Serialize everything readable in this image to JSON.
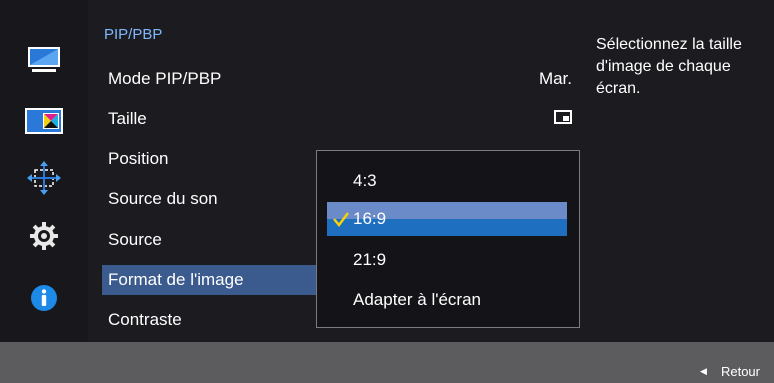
{
  "menu": {
    "title": "PIP/PBP",
    "items": [
      {
        "label": "Mode PIP/PBP",
        "value": "Mar."
      },
      {
        "label": "Taille",
        "value_icon": "pip-size-small-icon"
      },
      {
        "label": "Position"
      },
      {
        "label": "Source du son"
      },
      {
        "label": "Source"
      },
      {
        "label": "Format de l'image",
        "selected": true
      },
      {
        "label": "Contraste"
      }
    ]
  },
  "sidebar": {
    "icons": [
      "monitor-picture-icon",
      "color-icon",
      "resize-move-icon",
      "settings-gear-icon",
      "info-icon"
    ],
    "active": "color-icon"
  },
  "popup": {
    "options": [
      "4:3",
      "16:9",
      "21:9",
      "Adapter à l'écran"
    ],
    "selected": "16:9"
  },
  "help": {
    "text": "Sélectionnez la taille d'image de chaque écran."
  },
  "footer": {
    "back_label": "Retour",
    "back_icon": "left-triangle-icon"
  },
  "colors": {
    "accent": "#7fb8ff",
    "selection": "#3b5b8e",
    "popup_selected": "#1f6fc0",
    "check": "#f5d20a"
  }
}
